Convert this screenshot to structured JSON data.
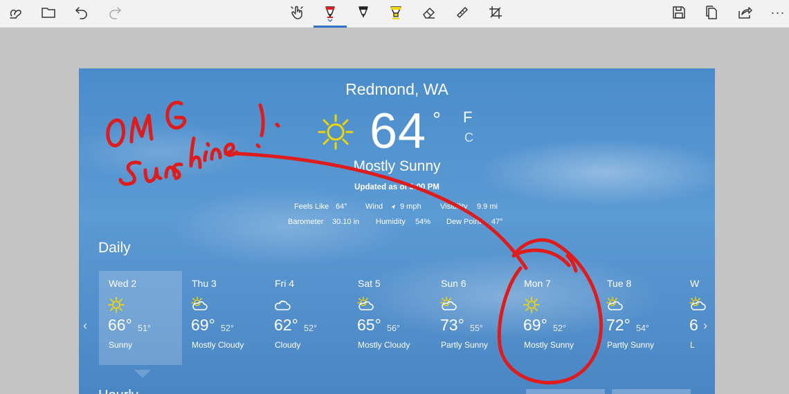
{
  "toolbar": {
    "left": [
      {
        "name": "touch-writing-icon"
      },
      {
        "name": "open-folder-icon"
      },
      {
        "name": "undo-icon"
      },
      {
        "name": "redo-icon"
      }
    ],
    "center": [
      {
        "name": "touch-pan-icon"
      },
      {
        "name": "ballpoint-pen-icon",
        "active": true
      },
      {
        "name": "pencil-icon"
      },
      {
        "name": "highlighter-icon"
      },
      {
        "name": "eraser-icon"
      },
      {
        "name": "ruler-icon"
      },
      {
        "name": "crop-icon"
      }
    ],
    "right": [
      {
        "name": "save-icon"
      },
      {
        "name": "copy-icon"
      },
      {
        "name": "share-icon"
      },
      {
        "name": "more-icon"
      }
    ],
    "more_label": "···"
  },
  "colors": {
    "pen_red": "#e01b1b",
    "highlighter_yellow": "#f2d600",
    "accent": "#2b6fc7",
    "sky": "#4f8fcd"
  },
  "weather": {
    "city": "Redmond, WA",
    "temp": "64",
    "degree": "°",
    "unit_f": "F",
    "unit_c": "C",
    "condition": "Mostly Sunny",
    "updated": "Updated as of 3:00 PM",
    "details": {
      "feels_like_label": "Feels Like",
      "feels_like_value": "64°",
      "wind_label": "Wind",
      "wind_value": "9 mph",
      "visibility_label": "Visibility",
      "visibility_value": "9.9 mi",
      "barometer_label": "Barometer",
      "barometer_value": "30.10 in",
      "humidity_label": "Humidity",
      "humidity_value": "54%",
      "dew_point_label": "Dew Point",
      "dew_point_value": "47°"
    },
    "daily_title": "Daily",
    "hourly_title": "Hourly",
    "days": [
      {
        "name": "Wed 2",
        "hi": "66°",
        "lo": "51°",
        "cond": "Sunny",
        "icon": "sunny-icon"
      },
      {
        "name": "Thu 3",
        "hi": "69°",
        "lo": "52°",
        "cond": "Mostly Cloudy",
        "icon": "partly-cloudy-icon"
      },
      {
        "name": "Fri 4",
        "hi": "62°",
        "lo": "52°",
        "cond": "Cloudy",
        "icon": "cloudy-icon"
      },
      {
        "name": "Sat 5",
        "hi": "65°",
        "lo": "56°",
        "cond": "Mostly Cloudy",
        "icon": "partly-cloudy-icon"
      },
      {
        "name": "Sun 6",
        "hi": "73°",
        "lo": "55°",
        "cond": "Partly Sunny",
        "icon": "partly-cloudy-icon"
      },
      {
        "name": "Mon 7",
        "hi": "69°",
        "lo": "52°",
        "cond": "Mostly Sunny",
        "icon": "sunny-icon"
      },
      {
        "name": "Tue 8",
        "hi": "72°",
        "lo": "54°",
        "cond": "Partly Sunny",
        "icon": "partly-cloudy-icon"
      },
      {
        "name": "W",
        "hi": "6",
        "lo": "",
        "cond": "L",
        "icon": "partly-cloudy-icon"
      }
    ],
    "nav_prev": "‹",
    "nav_next": "›"
  },
  "annotation": {
    "handwritten_text": "OMG Sunshine!"
  }
}
